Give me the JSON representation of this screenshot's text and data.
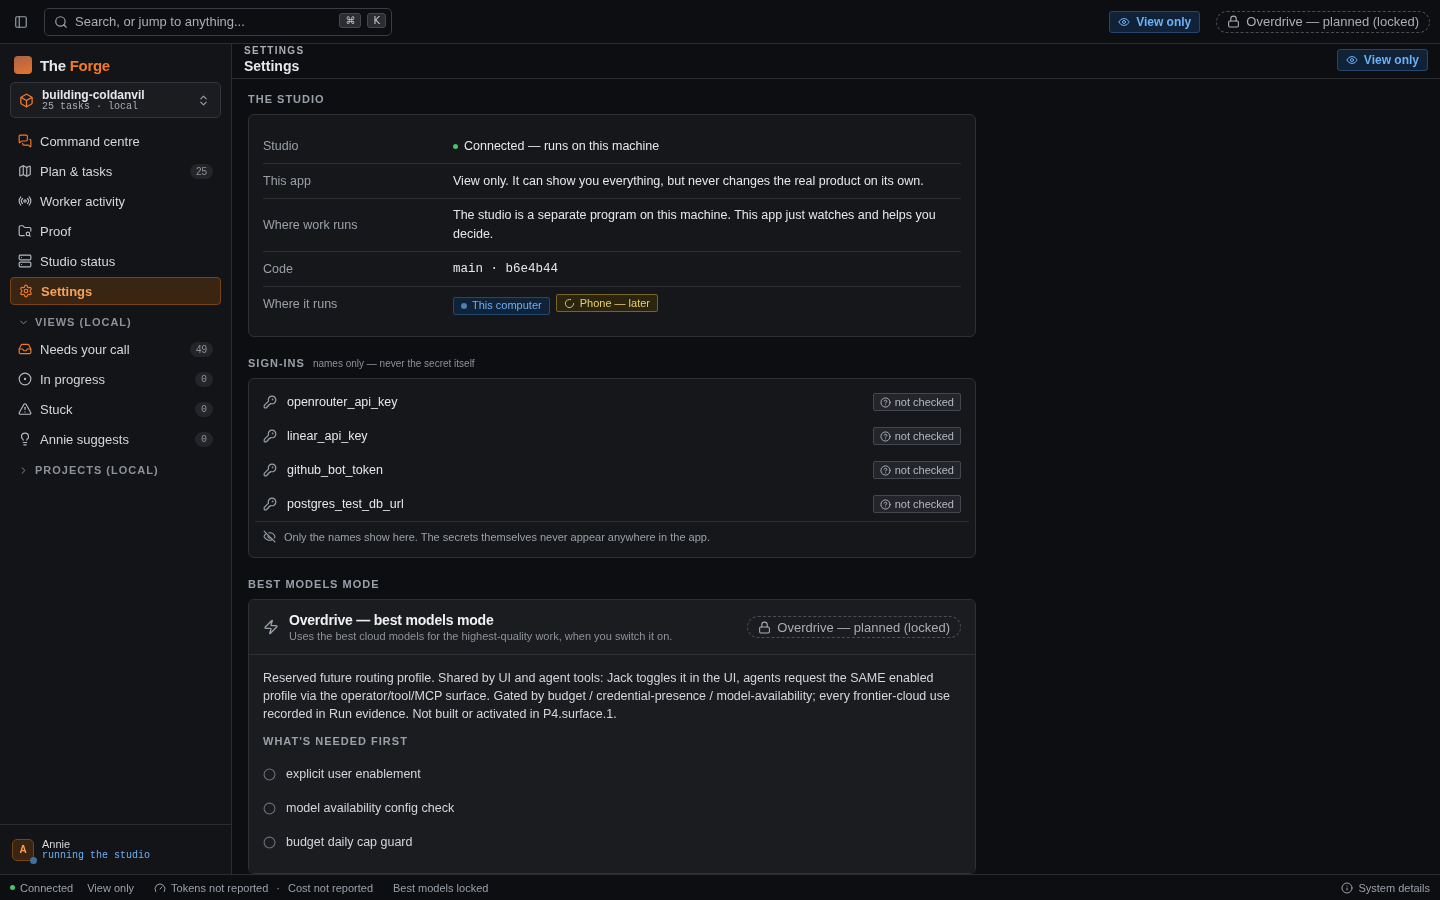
{
  "topbar": {
    "search_placeholder": "Search, or jump to anything...",
    "shortcut_keys": [
      "⌘",
      "K"
    ],
    "view_badge": "View only",
    "overdrive_badge": "Overdrive — planned (locked)"
  },
  "sidebar": {
    "brand": {
      "first": "The",
      "second": "Forge"
    },
    "project": {
      "name": "building-coldanvil",
      "meta": "25 tasks · local"
    },
    "nav": [
      {
        "label": "Command centre",
        "selected": false
      },
      {
        "label": "Plan & tasks",
        "count": "25",
        "selected": false
      },
      {
        "label": "Worker activity",
        "selected": false
      },
      {
        "label": "Proof",
        "selected": false
      },
      {
        "label": "Studio status",
        "selected": false
      },
      {
        "label": "Settings",
        "selected": true
      }
    ],
    "groups": [
      {
        "title": "VIEWS (LOCAL)",
        "expanded": true,
        "items": [
          {
            "label": "Needs your call",
            "count": "49",
            "selected": false
          },
          {
            "label": "In progress",
            "count": "0",
            "selected": false
          },
          {
            "label": "Stuck",
            "count": "0",
            "selected": false
          },
          {
            "label": "Annie suggests",
            "count": "0",
            "selected": false
          }
        ]
      },
      {
        "title": "PROJECTS (LOCAL)",
        "expanded": false
      }
    ],
    "user": {
      "initial": "A",
      "name": "Annie",
      "status": "running the studio"
    }
  },
  "header": {
    "eyebrow": "SETTINGS",
    "title": "Settings",
    "view_badge": "View only"
  },
  "studio": {
    "title": "THE STUDIO",
    "rows": [
      {
        "label": "Studio",
        "kind": "status",
        "value": "Connected — runs on this machine"
      },
      {
        "label": "This app",
        "kind": "text",
        "value": "View only. It can show you everything, but never changes the real product on its own."
      },
      {
        "label": "Where work runs",
        "kind": "text",
        "value": "The studio is a separate program on this machine. This app just watches and helps you decide."
      },
      {
        "label": "Code",
        "kind": "code",
        "value": "main · b6e4b44"
      },
      {
        "label": "Where it runs",
        "kind": "tags",
        "tags": [
          {
            "label": "This computer",
            "kind": "active"
          },
          {
            "label": "Phone — later",
            "kind": "pending"
          }
        ]
      }
    ]
  },
  "sign_ins": {
    "title": "SIGN-INS",
    "subtitle": "names only — never the secret itself",
    "items": [
      {
        "name": "openrouter_api_key",
        "status": "not checked"
      },
      {
        "name": "linear_api_key",
        "status": "not checked"
      },
      {
        "name": "github_bot_token",
        "status": "not checked"
      },
      {
        "name": "postgres_test_db_url",
        "status": "not checked"
      }
    ],
    "note": "Only the names show here. The secrets themselves never appear anywhere in the app."
  },
  "best_models": {
    "title": "BEST MODELS MODE",
    "card_title": "Overdrive — best models mode",
    "card_subtitle": "Uses the best cloud models for the highest-quality work, when you switch it on.",
    "badge": "Overdrive — planned (locked)",
    "description": "Reserved future routing profile. Shared by UI and agent tools: Jack toggles it in the UI, agents request the SAME enabled profile via the operator/tool/MCP surface. Gated by budget / credential-presence / model-availability; every frontier-cloud use recorded in Run evidence. Not built or activated in P4.surface.1.",
    "checklist_title": "WHAT'S NEEDED FIRST",
    "checklist": [
      {
        "label": "explicit user enablement",
        "checked": false
      },
      {
        "label": "model availability config check",
        "checked": false
      },
      {
        "label": "budget daily cap guard",
        "checked": false
      }
    ]
  },
  "status_bar": {
    "connection": "Connected",
    "mode": "View only",
    "tokens": "Tokens not reported",
    "separator": "·",
    "cost": "Cost not reported",
    "best_models": "Best models locked",
    "details": "System details"
  }
}
